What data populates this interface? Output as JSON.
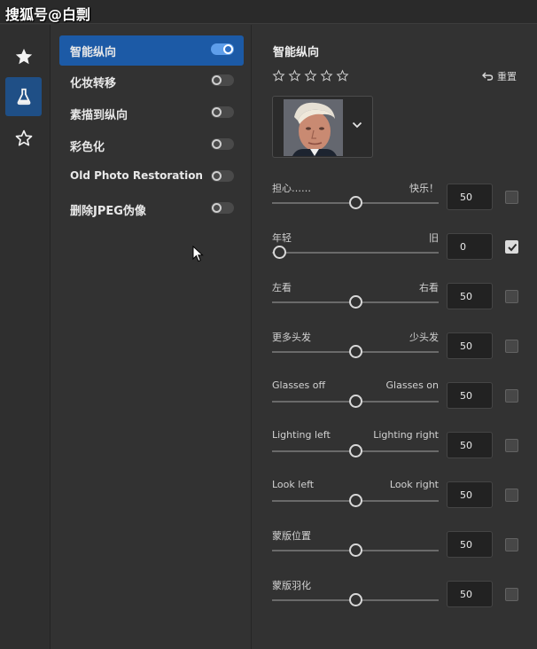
{
  "watermark": "搜狐号@白剽",
  "rail": {
    "items": [
      {
        "icon": "star-filled-icon",
        "active": false
      },
      {
        "icon": "flask-icon",
        "active": true
      },
      {
        "icon": "star-outline-icon",
        "active": false
      }
    ]
  },
  "filters": [
    {
      "label": "智能纵向",
      "enabled": true,
      "active": true
    },
    {
      "label": "化妆转移",
      "enabled": false,
      "active": false
    },
    {
      "label": "素描到纵向",
      "enabled": false,
      "active": false
    },
    {
      "label": "彩色化",
      "enabled": false,
      "active": false
    },
    {
      "label": "Old Photo Restoration",
      "enabled": false,
      "active": false
    },
    {
      "label": "删除JPEG伪像",
      "enabled": false,
      "active": false
    }
  ],
  "panel": {
    "title": "智能纵向",
    "rating": {
      "max": 5,
      "value": 0
    },
    "reset_label": "重置",
    "sliders": [
      {
        "left": "担心……",
        "right": "快乐！",
        "value": "50",
        "checked": false
      },
      {
        "left": "年轻",
        "right": "旧",
        "value": "0",
        "checked": true
      },
      {
        "left": "左看",
        "right": "右看",
        "value": "50",
        "checked": false
      },
      {
        "left": "更多头发",
        "right": "少头发",
        "value": "50",
        "checked": false
      },
      {
        "left": "Glasses off",
        "right": "Glasses on",
        "value": "50",
        "checked": false
      },
      {
        "left": "Lighting left",
        "right": "Lighting right",
        "value": "50",
        "checked": false
      },
      {
        "left": "Look left",
        "right": "Look right",
        "value": "50",
        "checked": false
      },
      {
        "left": "蒙版位置",
        "right": "",
        "value": "50",
        "checked": false
      },
      {
        "left": "蒙版羽化",
        "right": "",
        "value": "50",
        "checked": false
      }
    ]
  },
  "colors": {
    "accent": "#1c5aa6",
    "rail_active": "#1f4f86",
    "toggle_on": "#5e9eea"
  }
}
